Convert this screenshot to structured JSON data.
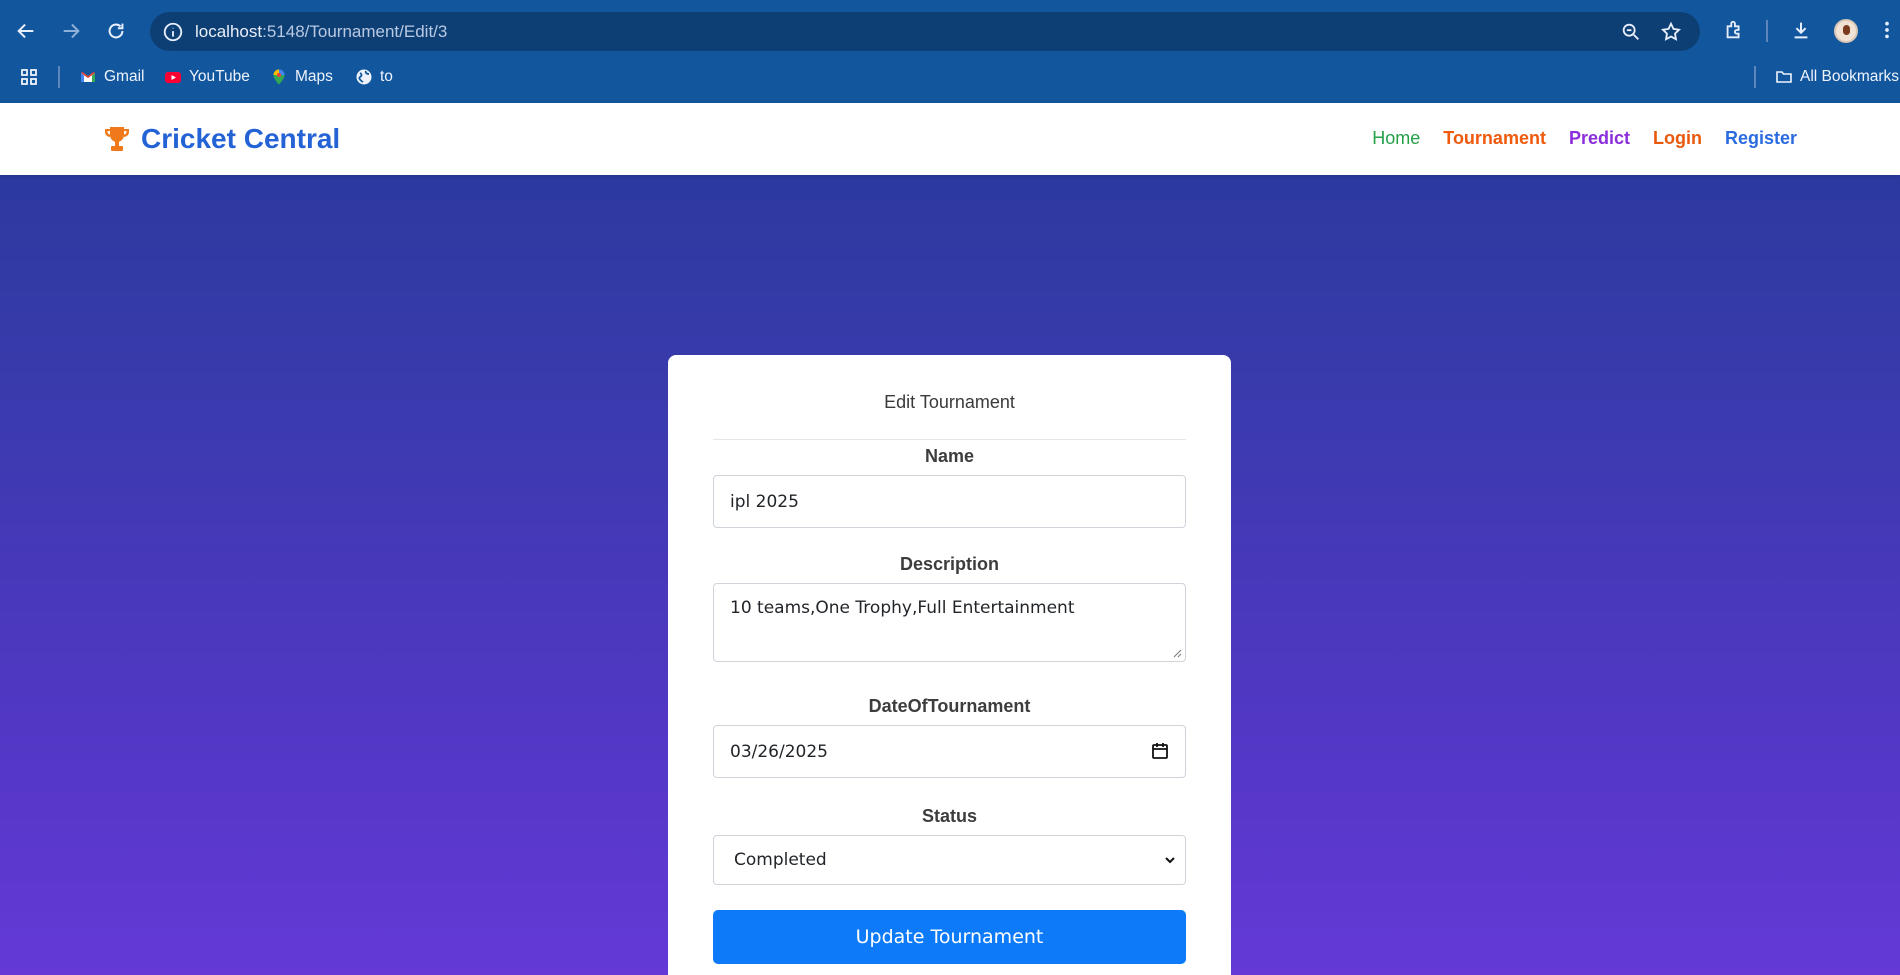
{
  "browser": {
    "url_host": "localhost",
    "url_path": ":5148/Tournament/Edit/3",
    "bookmarks": [
      {
        "label": "Gmail",
        "icon": "gmail-icon"
      },
      {
        "label": "YouTube",
        "icon": "youtube-icon"
      },
      {
        "label": "Maps",
        "icon": "maps-icon"
      },
      {
        "label": "to",
        "icon": "globe-icon"
      }
    ],
    "all_bookmarks": "All Bookmarks"
  },
  "navbar": {
    "brand": "Cricket Central",
    "links": {
      "home": "Home",
      "tournament": "Tournament",
      "predict": "Predict",
      "login": "Login",
      "register": "Register"
    }
  },
  "form": {
    "title": "Edit Tournament",
    "name_label": "Name",
    "name_value": "ipl 2025",
    "description_label": "Description",
    "description_value": "10 teams,One Trophy,Full Entertainment",
    "date_label": "DateOfTournament",
    "date_value": "03/26/2025",
    "status_label": "Status",
    "status_value": "Completed",
    "submit_label": "Update Tournament"
  },
  "colors": {
    "brand": "#2463d6",
    "trophy": "#f07a1a",
    "submit": "#0d7bf9",
    "home_link": "#24a049",
    "predict_link": "#8b2ddb"
  }
}
